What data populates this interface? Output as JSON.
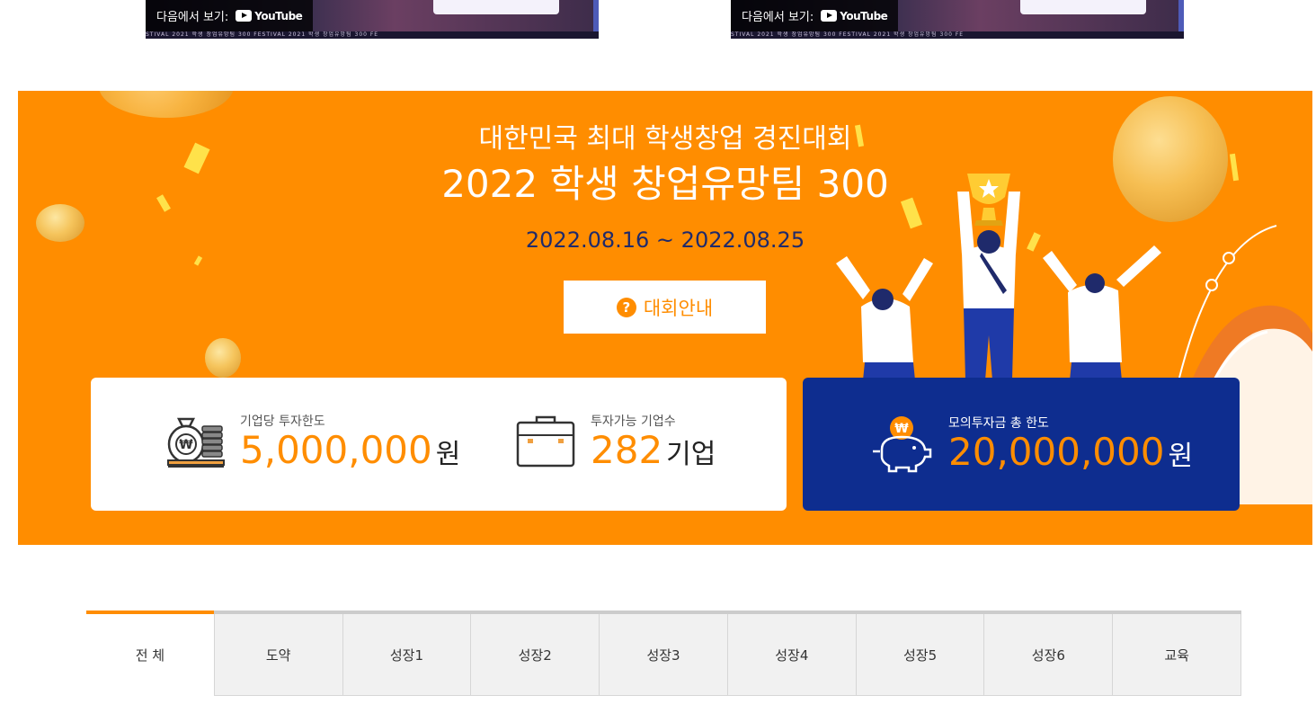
{
  "videos": [
    {
      "watch_label": "다음에서 보기:",
      "brand": "YouTube",
      "strip_text": "STIVAL 2021 학생 창업유망팀 300 FESTIVAL 2021 학생 창업유망팀 300 FE"
    },
    {
      "watch_label": "다음에서 보기:",
      "brand": "YouTube",
      "strip_text": "STIVAL 2021 학생 창업유망팀 300 FESTIVAL 2021 학생 창업유망팀 300 FE"
    }
  ],
  "banner": {
    "subtitle": "대한민국 최대 학생창업 경진대회",
    "title": "2022 학생 창업유망팀 300",
    "date": "2022.08.16 ~ 2022.08.25",
    "info_button": "대회안내",
    "info_icon": "?",
    "colors": {
      "background": "#ff8d00",
      "date": "#1f2a6b",
      "card_blue": "#0e2d8f"
    }
  },
  "stats": [
    {
      "label": "기업당 투자한도",
      "value": "5,000,000",
      "unit": "원",
      "icon": "money-bag-icon"
    },
    {
      "label": "투자가능 기업수",
      "value": "282",
      "unit": "기업",
      "icon": "briefcase-icon"
    },
    {
      "label": "모의투자금 총 한도",
      "value": "20,000,000",
      "unit": "원",
      "icon": "piggy-bank-icon"
    }
  ],
  "tabs": [
    {
      "label": "전 체",
      "active": true
    },
    {
      "label": "도약"
    },
    {
      "label": "성장1"
    },
    {
      "label": "성장2"
    },
    {
      "label": "성장3"
    },
    {
      "label": "성장4"
    },
    {
      "label": "성장5"
    },
    {
      "label": "성장6"
    },
    {
      "label": "교육"
    }
  ]
}
